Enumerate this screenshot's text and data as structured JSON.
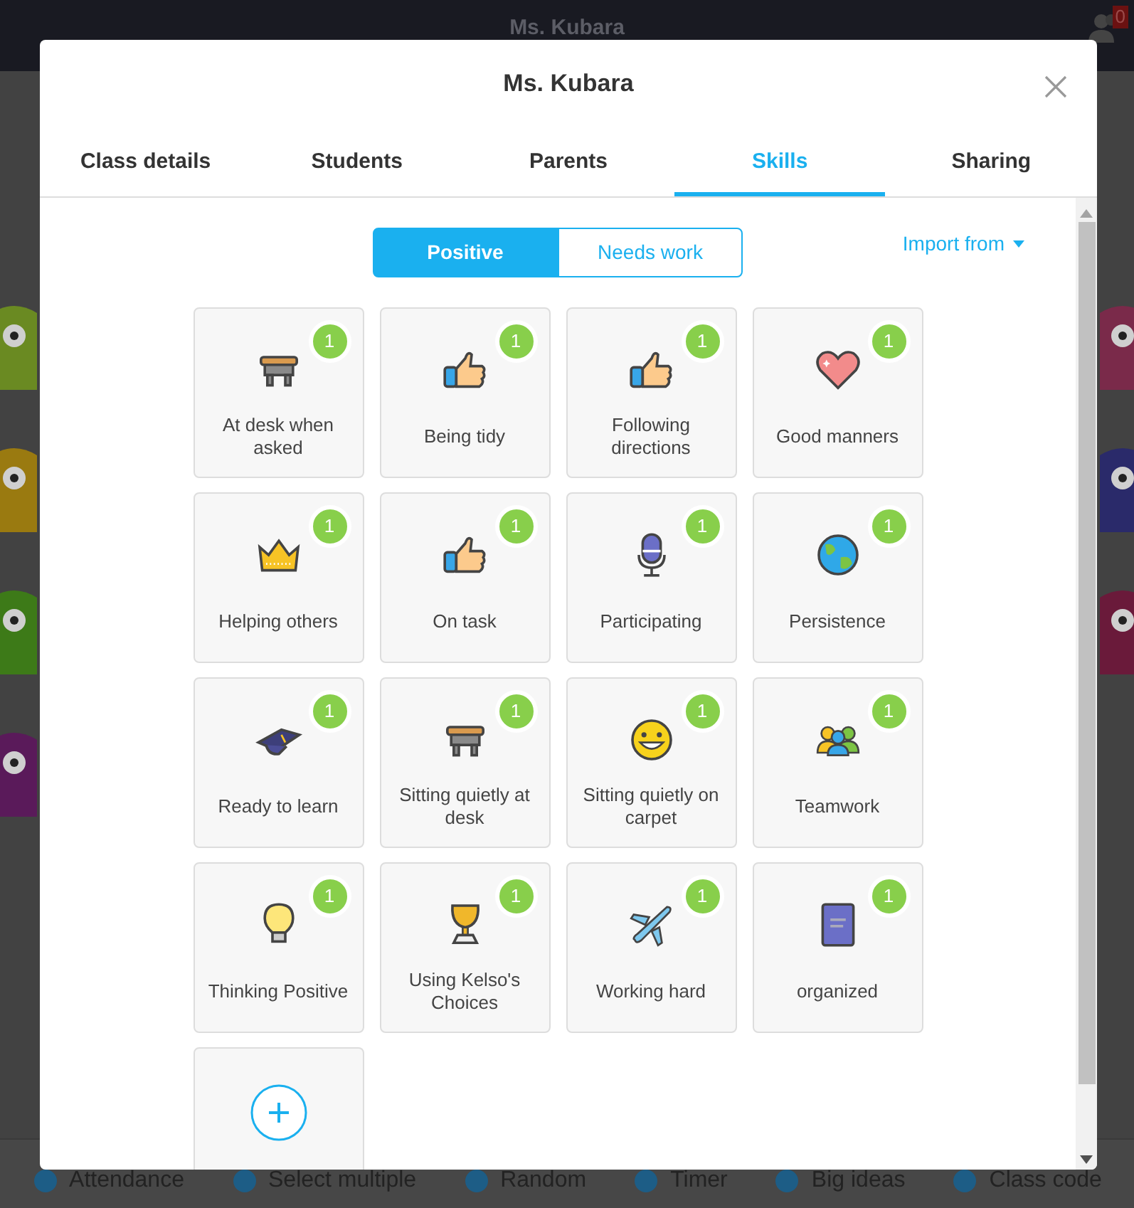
{
  "top_bar": {
    "title": "Ms. Kubara",
    "badge": "0"
  },
  "dialog": {
    "title": "Ms. Kubara",
    "tabs": [
      {
        "label": "Class details",
        "selected": false
      },
      {
        "label": "Students",
        "selected": false
      },
      {
        "label": "Parents",
        "selected": false
      },
      {
        "label": "Skills",
        "selected": true
      },
      {
        "label": "Sharing",
        "selected": false
      }
    ],
    "segments": [
      {
        "label": "Positive",
        "selected": true
      },
      {
        "label": "Needs work",
        "selected": false
      }
    ],
    "import_button": "Import from",
    "skills": [
      {
        "name": "At desk when asked",
        "points": "1"
      },
      {
        "name": "Being tidy",
        "points": "1"
      },
      {
        "name": "Following directions",
        "points": "1"
      },
      {
        "name": "Good manners",
        "points": "1"
      },
      {
        "name": "Helping others",
        "points": "1"
      },
      {
        "name": "On task",
        "points": "1"
      },
      {
        "name": "Participating",
        "points": "1"
      },
      {
        "name": "Persistence",
        "points": "1"
      },
      {
        "name": "Ready to learn",
        "points": "1"
      },
      {
        "name": "Sitting quietly at desk",
        "points": "1"
      },
      {
        "name": "Sitting quietly on carpet",
        "points": "1"
      },
      {
        "name": "Teamwork",
        "points": "1"
      },
      {
        "name": "Thinking Positive",
        "points": "1"
      },
      {
        "name": "Using Kelso's Choices",
        "points": "1"
      },
      {
        "name": "Working hard",
        "points": "1"
      },
      {
        "name": "organized",
        "points": "1"
      }
    ]
  },
  "toolbar": [
    "Attendance",
    "Select multiple",
    "Random",
    "Timer",
    "Big ideas",
    "Class code"
  ]
}
